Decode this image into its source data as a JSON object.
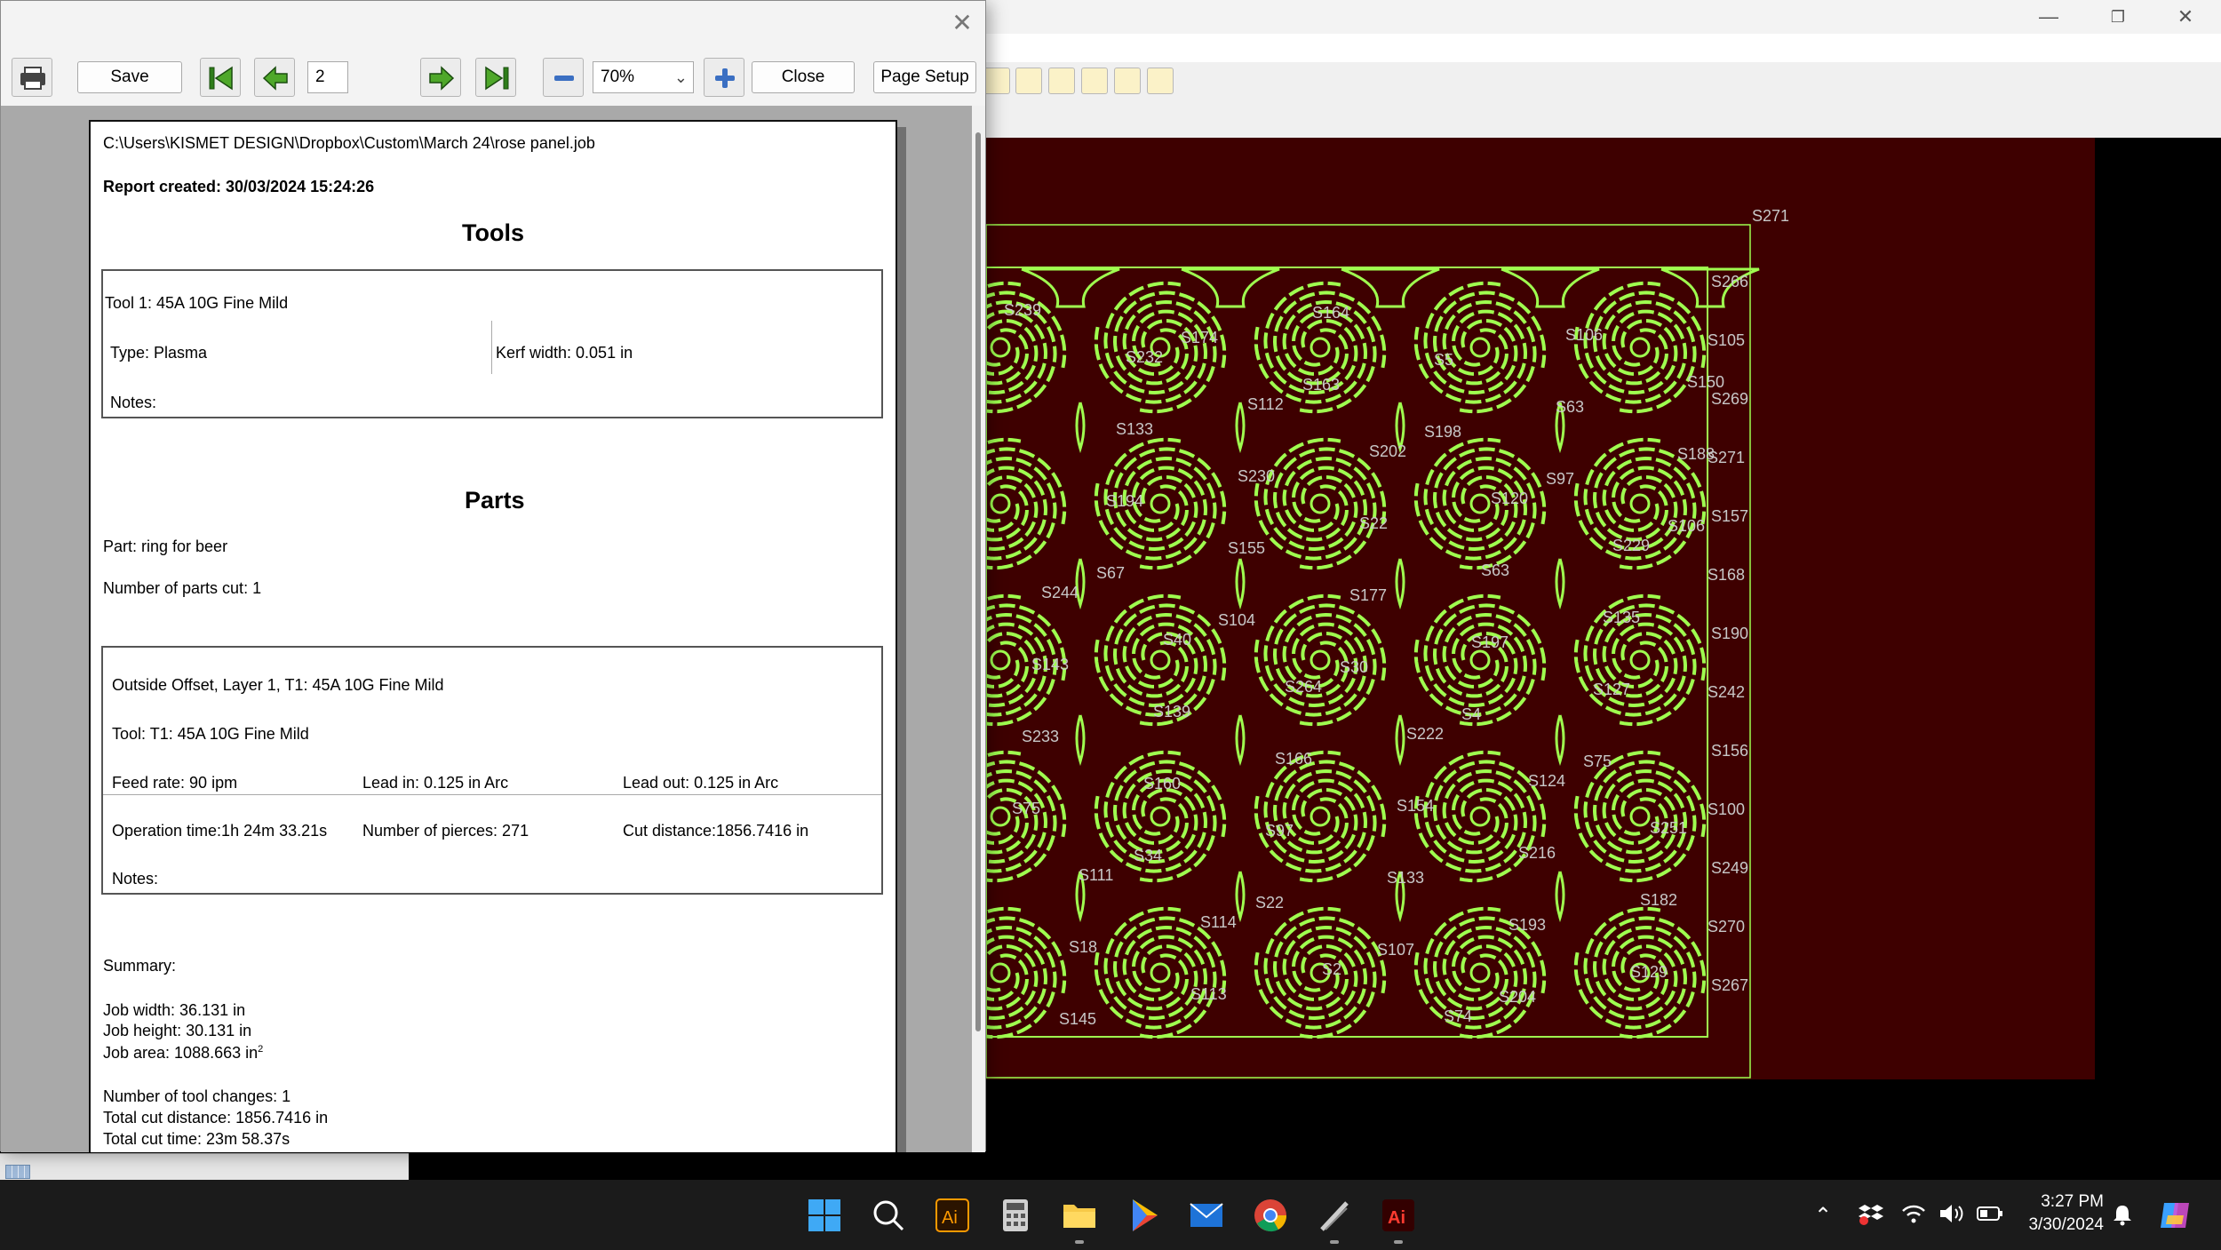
{
  "dialog": {
    "toolbar": {
      "print_icon": "printer-icon",
      "save_label": "Save",
      "page_number": "2",
      "zoom_value": "70%",
      "close_label": "Close",
      "page_setup_label": "Page Setup"
    },
    "close_glyph": "✕"
  },
  "report": {
    "path": "C:\\Users\\KISMET DESIGN\\Dropbox\\Custom\\March 24\\rose panel.job",
    "created": "Report created: 30/03/2024 15:24:26",
    "tools_title": "Tools",
    "tool": {
      "name": "Tool 1: 45A 10G Fine Mild",
      "type": "Type: Plasma",
      "kerf": "Kerf width: 0.051 in",
      "notes": "Notes:"
    },
    "parts_title": "Parts",
    "part_name": "Part: ring for beer",
    "parts_cut": "Number of parts cut: 1",
    "operation": {
      "header": "Outside Offset, Layer 1, T1: 45A 10G Fine Mild",
      "tool": "Tool: T1: 45A 10G Fine Mild",
      "feed_rate": "Feed rate: 90 ipm",
      "lead_in": "Lead in: 0.125 in Arc",
      "lead_out": "Lead out: 0.125 in Arc",
      "op_time": "Operation time:1h 24m 33.21s",
      "pierces": "Number of pierces: 271",
      "cut_distance": "Cut distance:1856.7416 in",
      "notes": "Notes:"
    },
    "summary": {
      "label": "Summary:",
      "job_width": "Job width: 36.131 in",
      "job_height": "Job height: 30.131 in",
      "job_area": "Job area: 1088.663 in",
      "job_area_unit_sup": "2",
      "tool_changes": "Number of tool changes: 1",
      "total_distance": "Total cut distance: 1856.7416 in",
      "total_time": "Total cut time: 23m 58.37s"
    }
  },
  "cad": {
    "window_controls": [
      "—",
      "❐",
      "✕"
    ],
    "part_labels": [
      "S271",
      "S266",
      "S105",
      "S269",
      "S271",
      "S157",
      "S168",
      "S190",
      "S242",
      "S156",
      "S100",
      "S249",
      "S270",
      "S267",
      "S239",
      "S232",
      "S112",
      "S202",
      "S120",
      "S229",
      "S244",
      "S40",
      "S264",
      "S222",
      "S124",
      "S251",
      "S111",
      "S114",
      "S2",
      "S74",
      "S106",
      "S150",
      "S133",
      "S230",
      "S22",
      "S63",
      "S135",
      "S143",
      "S139",
      "S166",
      "S154",
      "S216",
      "S182",
      "S18",
      "S113",
      "S164",
      "S5",
      "S63",
      "S188",
      "S194",
      "S155",
      "S177",
      "S197",
      "S127",
      "S233",
      "S160",
      "S97",
      "S133",
      "S193",
      "S129",
      "S145",
      "S174",
      "S163",
      "S198",
      "S97",
      "S106",
      "S67",
      "S104",
      "S30",
      "S4",
      "S75",
      "S75",
      "S34",
      "S22",
      "S107",
      "S204"
    ],
    "canvas_bg": "#3e0000",
    "line_color": "#9fff4f"
  },
  "taskbar": {
    "apps": [
      "windows-start-icon",
      "search-icon",
      "illustrator-icon",
      "calculator-icon",
      "file-explorer-icon",
      "play-store-icon",
      "mail-icon",
      "chrome-icon",
      "pen-tool-icon",
      "illustrator-active-icon"
    ],
    "time": "3:27 PM",
    "date": "3/30/2024"
  }
}
